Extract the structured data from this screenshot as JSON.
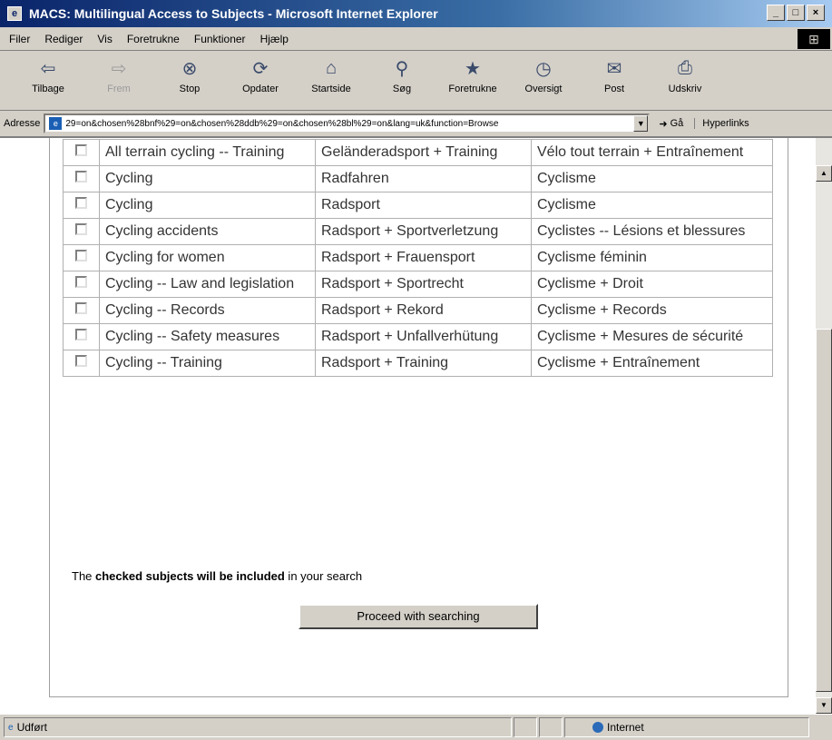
{
  "window": {
    "title": "MACS: Multilingual Access to Subjects - Microsoft Internet Explorer"
  },
  "menu": [
    "Filer",
    "Rediger",
    "Vis",
    "Foretrukne",
    "Funktioner",
    "Hjælp"
  ],
  "toolbar": {
    "buttons": [
      {
        "label": "Tilbage",
        "icon": "back-arrow-icon",
        "disabled": false
      },
      {
        "label": "Frem",
        "icon": "forward-arrow-icon",
        "disabled": true
      },
      {
        "label": "Stop",
        "icon": "stop-icon",
        "disabled": false
      },
      {
        "label": "Opdater",
        "icon": "refresh-icon",
        "disabled": false
      },
      {
        "label": "Startside",
        "icon": "home-icon",
        "disabled": false
      },
      {
        "label": "Søg",
        "icon": "search-icon",
        "disabled": false
      },
      {
        "label": "Foretrukne",
        "icon": "favorites-icon",
        "disabled": false
      },
      {
        "label": "Oversigt",
        "icon": "history-icon",
        "disabled": false
      },
      {
        "label": "Post",
        "icon": "mail-icon",
        "disabled": false
      },
      {
        "label": "Udskriv",
        "icon": "print-icon",
        "disabled": false
      }
    ]
  },
  "address": {
    "label": "Adresse",
    "url": "29=on&chosen%28bnf%29=on&chosen%28ddb%29=on&chosen%28bl%29=on&lang=uk&function=Browse",
    "go_label": "Gå",
    "links_label": "Hyperlinks"
  },
  "subjects": [
    {
      "en": "All terrain cycling -- Training",
      "de": "Geländeradsport + Training",
      "fr": "Vélo tout terrain + Entraînement"
    },
    {
      "en": "Cycling",
      "de": "Radfahren",
      "fr": "Cyclisme"
    },
    {
      "en": "Cycling",
      "de": "Radsport",
      "fr": "Cyclisme"
    },
    {
      "en": "Cycling accidents",
      "de": "Radsport + Sportverletzung",
      "fr": "Cyclistes -- Lésions et blessures"
    },
    {
      "en": "Cycling for women",
      "de": "Radsport + Frauensport",
      "fr": "Cyclisme féminin"
    },
    {
      "en": "Cycling -- Law and legislation",
      "de": "Radsport + Sportrecht",
      "fr": "Cyclisme + Droit"
    },
    {
      "en": "Cycling -- Records",
      "de": "Radsport + Rekord",
      "fr": "Cyclisme + Records"
    },
    {
      "en": "Cycling -- Safety measures",
      "de": "Radsport + Unfallverhütung",
      "fr": "Cyclisme + Mesures de sécurité"
    },
    {
      "en": "Cycling -- Training",
      "de": "Radsport + Training",
      "fr": "Cyclisme + Entraînement"
    }
  ],
  "notice": {
    "prefix": "The ",
    "bold": "checked subjects will be included",
    "suffix": " in your search"
  },
  "proceed_label": "Proceed with searching",
  "status": {
    "text": "Udført",
    "zone": "Internet"
  }
}
